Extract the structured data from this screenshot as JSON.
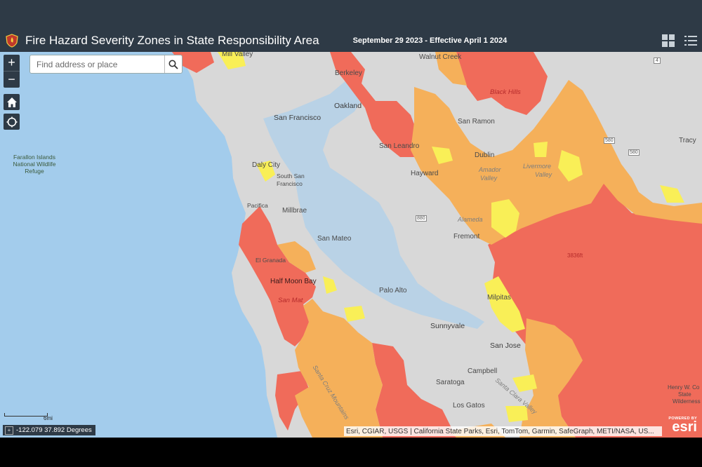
{
  "header": {
    "title": "Fire Hazard Severity Zones in State Responsibility Area",
    "date": "September 29 2023 - Effective April 1 2024",
    "logo_icon": "fire-agency-badge-icon",
    "buttons": [
      {
        "icon": "grid-icon",
        "name": "apps-grid-button"
      },
      {
        "icon": "list-icon",
        "name": "layer-list-button"
      }
    ]
  },
  "controls": {
    "zoom_in": "+",
    "zoom_out": "−",
    "home_icon": "home-icon",
    "locate_icon": "locate-icon"
  },
  "search": {
    "placeholder": "Find address or place",
    "value": "",
    "button_icon": "search-icon"
  },
  "map": {
    "labels": {
      "mill_valley": "Mill Valley",
      "walnut_creek": "Walnut Creek",
      "berkeley": "Berkeley",
      "black_hills": "Black Hills",
      "oakland": "Oakland",
      "san_francisco": "San Francisco",
      "san_ramon": "San Ramon",
      "san_leandro": "San Leandro",
      "dublin": "Dublin",
      "tracy": "Tracy",
      "amador": "Amador",
      "valley": "Valley",
      "livermore": "Livermore",
      "valley2": "Valley",
      "daly_city": "Daly City",
      "south_san": "South San",
      "francisco": "Francisco",
      "hayward": "Hayward",
      "pacifica": "Pacifica",
      "millbrae": "Millbrae",
      "san_mateo": "San Mateo",
      "fremont": "Fremont",
      "el_granada": "El Granada",
      "half_moon_bay": "Half Moon Bay",
      "san_mateo_hills": "San Mat",
      "palo_alto": "Palo Alto",
      "milpitas": "Milpitas",
      "sunnyvale": "Sunnyvale",
      "san_jose": "San Jose",
      "campbell": "Campbell",
      "saratoga": "Saratoga",
      "los_gatos": "Los Gatos",
      "santa_cruz_mtns": "Santa Cruz Mountains",
      "santa_clara_valley": "Santa Clara Valley",
      "mt_hamilton": "3836ft",
      "alameda": "Alameda",
      "henry_coe_1": "Henry W. Co",
      "henry_coe_2": "State",
      "henry_coe_3": "Wilderness",
      "refuge": "Farallon Islands National Wildlife Refuge",
      "hwy_580_a": "580",
      "hwy_580_b": "580",
      "hwy_880": "880",
      "hwy_4": "4"
    },
    "colors": {
      "ocean": "#a3ccec",
      "land": "#d8d8d8",
      "bay": "#b9d2e6",
      "very_high": "#f06b5a",
      "high": "#f5b05a",
      "moderate": "#f9ef57",
      "chrome": "#2e3a46"
    }
  },
  "scale": {
    "label": "6mi"
  },
  "coords": {
    "text": "-122.079 37.892 Degrees"
  },
  "attribution": "Esri, CGIAR, USGS | California State Parks, Esri, TomTom, Garmin, SafeGraph, METI/NASA, US...",
  "esri": {
    "powered": "POWERED BY",
    "name": "esri"
  }
}
